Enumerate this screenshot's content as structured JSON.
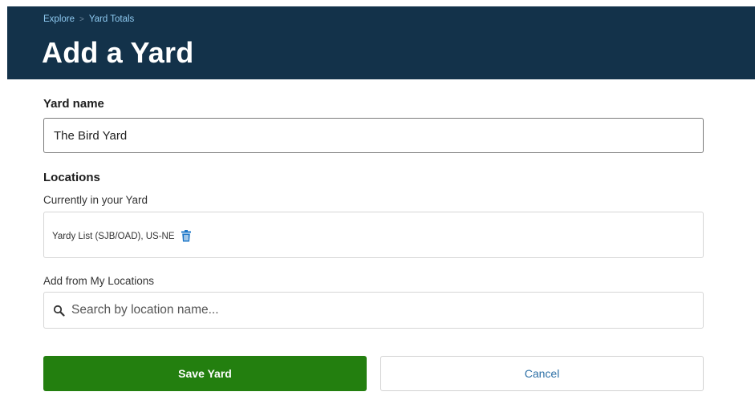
{
  "header": {
    "breadcrumb": {
      "items": [
        "Explore",
        "Yard Totals"
      ],
      "separator": ">"
    },
    "title": "Add a Yard",
    "background_color": "#13324a"
  },
  "form": {
    "yard_name": {
      "label": "Yard name",
      "value": "The Bird Yard"
    },
    "locations": {
      "heading": "Locations",
      "current_label": "Currently in your Yard",
      "current_items": [
        {
          "name": "Yardy List (SJB/OAD), US-NE",
          "icon": "trash-icon"
        }
      ],
      "add_label": "Add from My Locations",
      "search": {
        "placeholder": "Search by location name...",
        "icon": "search-icon"
      }
    }
  },
  "actions": {
    "save_label": "Save Yard",
    "cancel_label": "Cancel",
    "save_color": "#237f0f",
    "cancel_text_color": "#2c6fa5"
  }
}
